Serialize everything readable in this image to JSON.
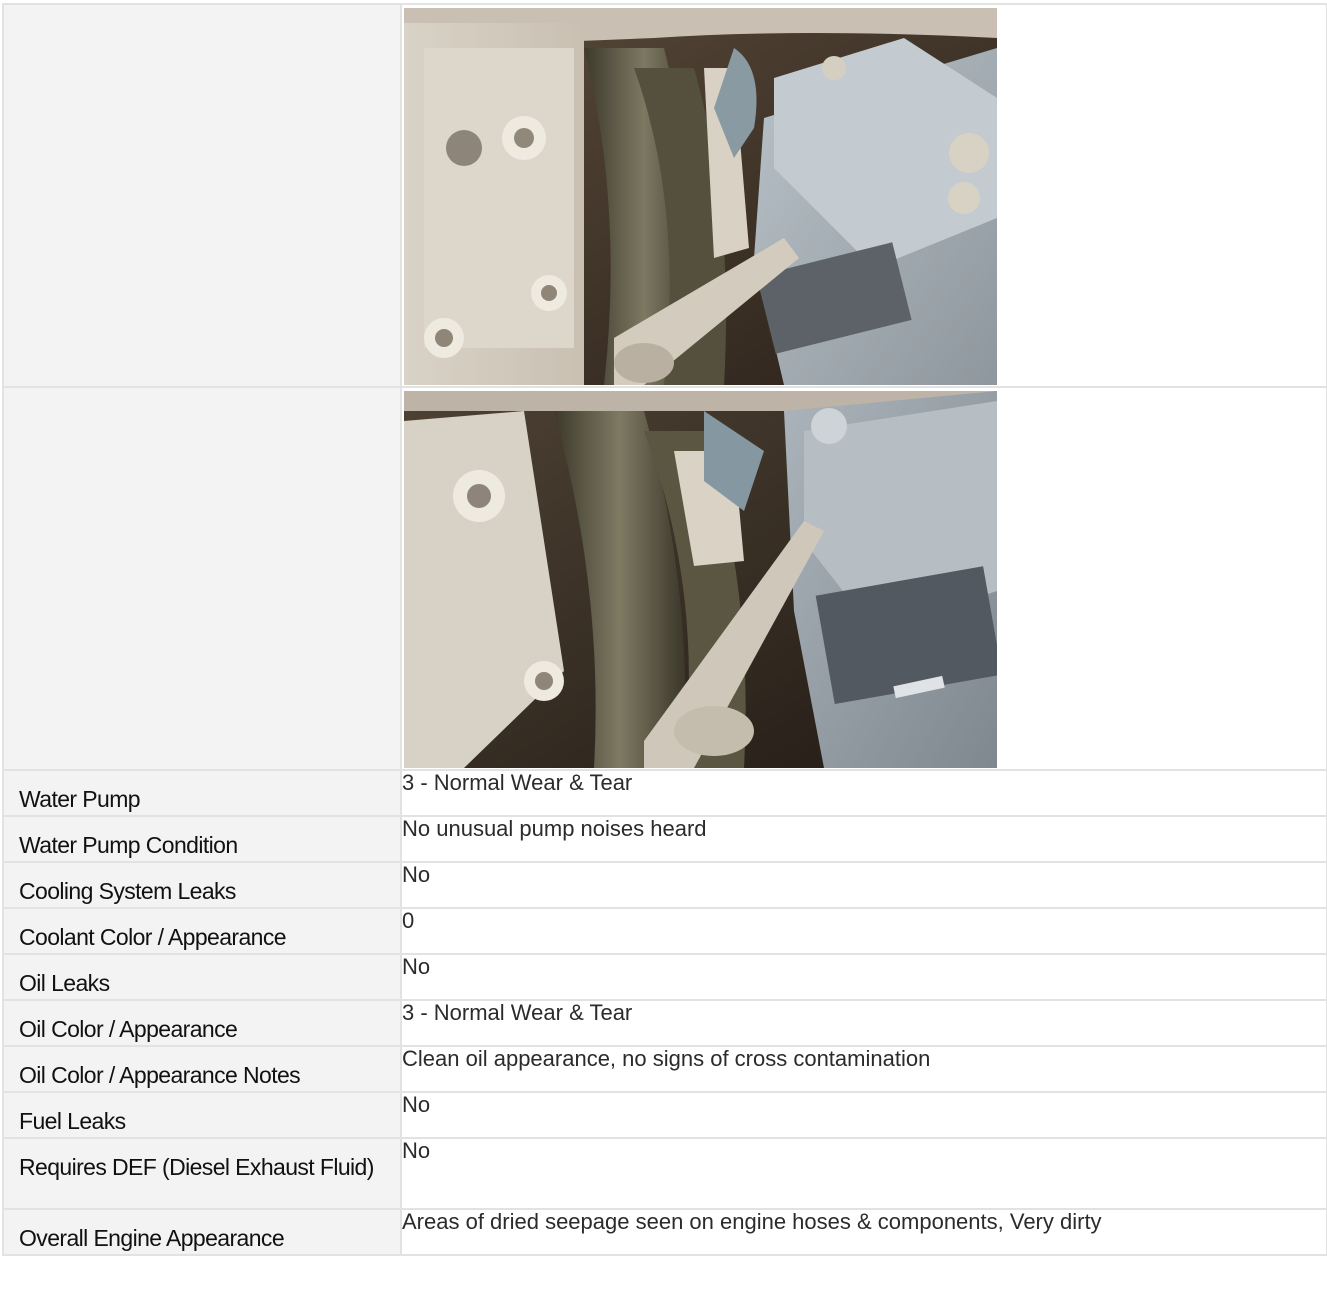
{
  "rows": [
    {
      "label": "Water Pump",
      "value": "3 - Normal Wear & Tear"
    },
    {
      "label": "Water Pump Condition",
      "value": "No unusual pump noises heard"
    },
    {
      "label": "Cooling System Leaks",
      "value": "No"
    },
    {
      "label": "Coolant Color / Appearance",
      "value": "0"
    },
    {
      "label": "Oil Leaks",
      "value": "No"
    },
    {
      "label": "Oil Color / Appearance",
      "value": "3 - Normal Wear & Tear"
    },
    {
      "label": "Oil Color / Appearance Notes",
      "value": "Clean oil appearance, no signs of cross contamination"
    },
    {
      "label": "Fuel Leaks",
      "value": "No"
    },
    {
      "label": "Requires DEF (Diesel Exhaust Fluid)",
      "value": "No"
    },
    {
      "label": "Overall Engine Appearance",
      "value": "Areas of dried seepage seen on engine hoses & components, Very dirty"
    }
  ],
  "colors": {
    "border": "#e2e2e2",
    "label_bg": "#f3f3f3",
    "label_text": "#111111",
    "value_text": "#2b2b2b"
  }
}
